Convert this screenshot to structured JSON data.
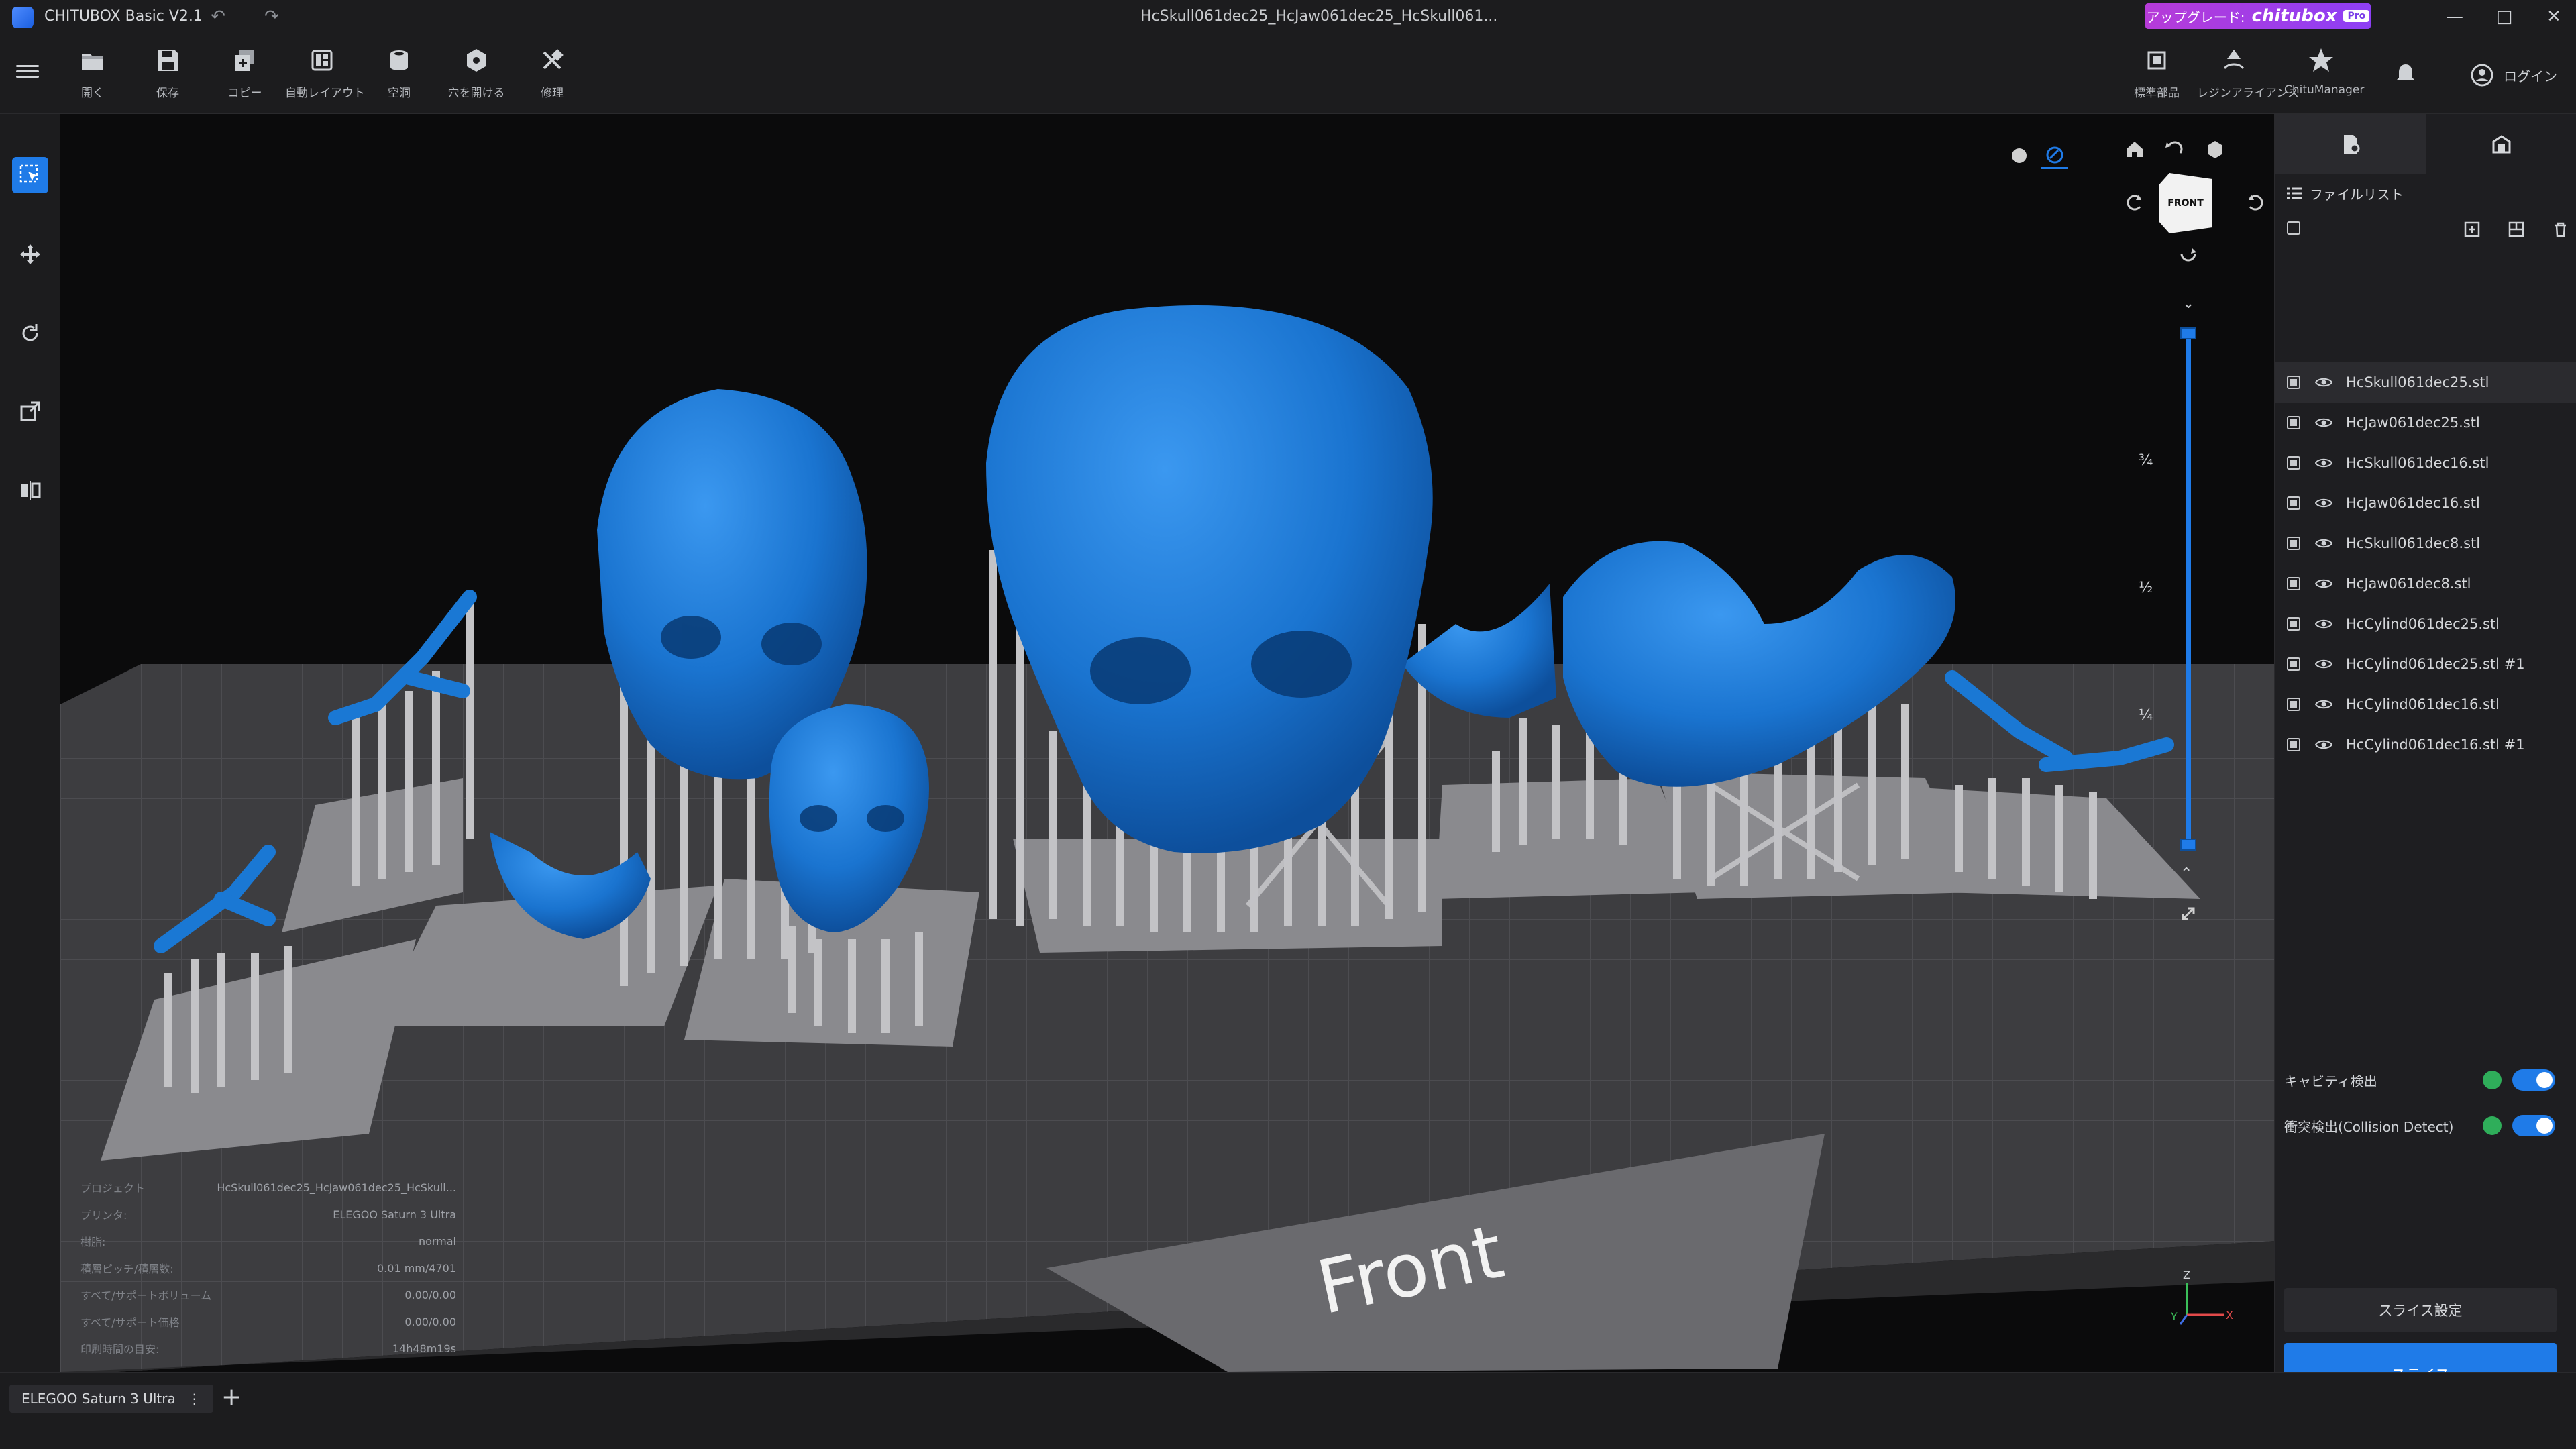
{
  "app": {
    "title": "CHITUBOX Basic V2.1",
    "doc_title": "HcSkull061dec25_HcJaw061dec25_HcSkull061..."
  },
  "upgrade": {
    "label": "アップグレード:",
    "brand": "chitubox",
    "badge": "Pro"
  },
  "window": {
    "minimize": "—",
    "maximize": "□",
    "close": "✕"
  },
  "toolbar": {
    "tools": [
      {
        "label": "開く",
        "icon": "folder-icon"
      },
      {
        "label": "保存",
        "icon": "save-icon"
      },
      {
        "label": "コピー",
        "icon": "copy-icon"
      },
      {
        "label": "自動レイアウト",
        "icon": "auto-layout-icon"
      },
      {
        "label": "空洞",
        "icon": "hollow-icon"
      },
      {
        "label": "穴を開ける",
        "icon": "drill-hole-icon"
      },
      {
        "label": "修理",
        "icon": "repair-icon"
      }
    ],
    "right_tools": [
      {
        "label": "標準部品",
        "icon": "standard-parts-icon"
      },
      {
        "label": "レジンアライアンス",
        "icon": "resin-alliance-icon"
      },
      {
        "label": "ChituManager",
        "icon": "chitumanager-icon"
      }
    ],
    "login": "ログイン"
  },
  "left_tools": [
    "select-icon",
    "move-icon",
    "rotate-icon",
    "scale-icon",
    "mirror-icon"
  ],
  "viewport": {
    "view_cube": "FRONT",
    "platform_text": "Front",
    "slider_labels": [
      "¾",
      "½",
      "¼"
    ],
    "axis": {
      "x": "X",
      "y": "Y",
      "z": "Z"
    }
  },
  "info": {
    "rows": [
      {
        "k": "プロジェクト",
        "v": "HcSkull061dec25_HcJaw061dec25_HcSkull..."
      },
      {
        "k": "プリンタ:",
        "v": "ELEGOO Saturn 3 Ultra"
      },
      {
        "k": "樹脂:",
        "v": "normal"
      },
      {
        "k": "積層ピッチ/積層数:",
        "v": "0.01 mm/4701"
      },
      {
        "k": "すべて/サポートボリューム",
        "v": "0.00/0.00"
      },
      {
        "k": "すべて/サポート価格",
        "v": "0.00/0.00"
      },
      {
        "k": "印刷時間の目安:",
        "v": "14h48m19s"
      }
    ]
  },
  "right_panel": {
    "file_list_title": "ファイルリスト",
    "files": [
      "HcSkull061dec25.stl",
      "HcJaw061dec25.stl",
      "HcSkull061dec16.stl",
      "HcJaw061dec16.stl",
      "HcSkull061dec8.stl",
      "HcJaw061dec8.stl",
      "HcCylind061dec25.stl",
      "HcCylind061dec25.stl #1",
      "HcCylind061dec16.stl",
      "HcCylind061dec16.stl #1"
    ],
    "cavity_detect": "キャビティ検出",
    "collision_detect": "衝突検出(Collision Detect)",
    "slice_settings": "スライス設定",
    "slice": "スライス"
  },
  "bottom": {
    "printer_tab": "ELEGOO Saturn 3 Ultra",
    "more": "⋮",
    "add": "+"
  },
  "colors": {
    "accent": "#1f7be8",
    "model": "#1a78d4",
    "support": "#b8b8b8",
    "plate": "#4a4a4d"
  }
}
